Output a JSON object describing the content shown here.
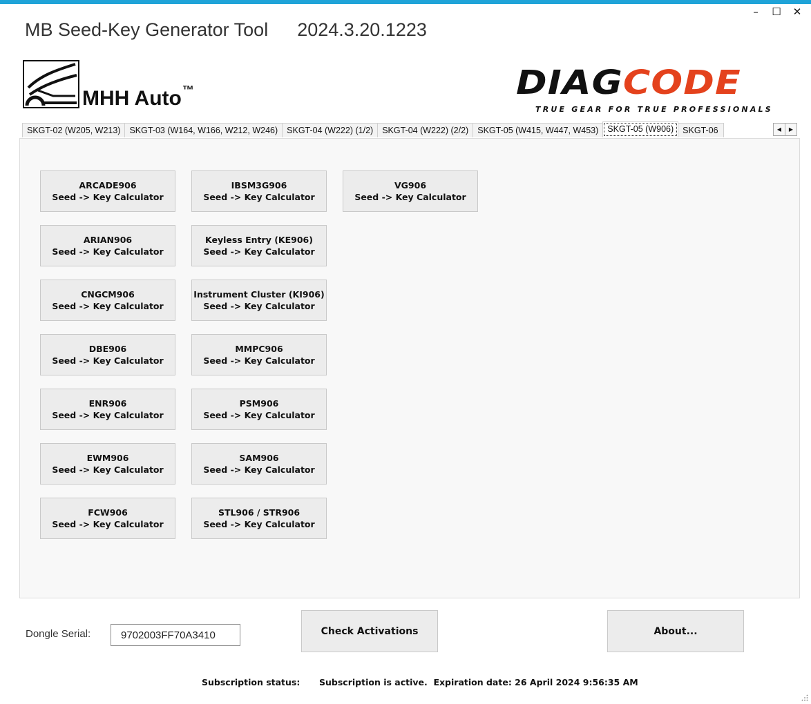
{
  "window": {
    "title": "MB Seed-Key Generator Tool",
    "version": "2024.3.20.1223",
    "controls": {
      "minimize": "–",
      "maximize": "☐",
      "close": "✕"
    },
    "accent_color": "#1fa3d8"
  },
  "logos": {
    "mhh": {
      "text": "MHH Auto",
      "tm": "™"
    },
    "diagcode": {
      "part1": "DIAG",
      "part2": "CODE",
      "tagline": "TRUE GEAR FOR TRUE PROFESSIONALS",
      "brand_color": "#e4421d"
    }
  },
  "tabs": [
    {
      "label": "SKGT-02 (W205, W213)"
    },
    {
      "label": "SKGT-03 (W164, W166, W212, W246)"
    },
    {
      "label": "SKGT-04 (W222) (1/2)"
    },
    {
      "label": "SKGT-04 (W222) (2/2)"
    },
    {
      "label": "SKGT-05 (W415, W447, W453)"
    },
    {
      "label": "SKGT-05 (W906)",
      "active": true
    },
    {
      "label": "SKGT-06"
    }
  ],
  "tab_scroll": {
    "left": "◀",
    "right": "▶"
  },
  "calculators": [
    {
      "name": "ARCADE906",
      "sub": "Seed -> Key Calculator"
    },
    {
      "name": "ARIAN906",
      "sub": "Seed -> Key Calculator"
    },
    {
      "name": "CNGCM906",
      "sub": "Seed -> Key Calculator"
    },
    {
      "name": "DBE906",
      "sub": "Seed -> Key Calculator"
    },
    {
      "name": "ENR906",
      "sub": "Seed -> Key Calculator"
    },
    {
      "name": "EWM906",
      "sub": "Seed -> Key Calculator"
    },
    {
      "name": "FCW906",
      "sub": "Seed -> Key Calculator"
    },
    {
      "name": "IBSM3G906",
      "sub": "Seed -> Key Calculator"
    },
    {
      "name": "Keyless Entry (KE906)",
      "sub": "Seed -> Key Calculator"
    },
    {
      "name": "Instrument Cluster (KI906)",
      "sub": "Seed -> Key Calculator"
    },
    {
      "name": "MMPC906",
      "sub": "Seed -> Key Calculator"
    },
    {
      "name": "PSM906",
      "sub": "Seed -> Key Calculator"
    },
    {
      "name": "SAM906",
      "sub": "Seed -> Key Calculator"
    },
    {
      "name": "STL906 / STR906",
      "sub": "Seed -> Key Calculator"
    },
    {
      "name": "VG906",
      "sub": "Seed -> Key Calculator"
    }
  ],
  "footer": {
    "dongle_label": "Dongle Serial:",
    "dongle_serial": "9702003FF70A3410",
    "check_button": "Check Activations",
    "about_button": "About...",
    "subscription_label": "Subscription status:",
    "subscription_value": "Subscription is active.  Expiration date: 26 April 2024 9:56:35 AM"
  }
}
